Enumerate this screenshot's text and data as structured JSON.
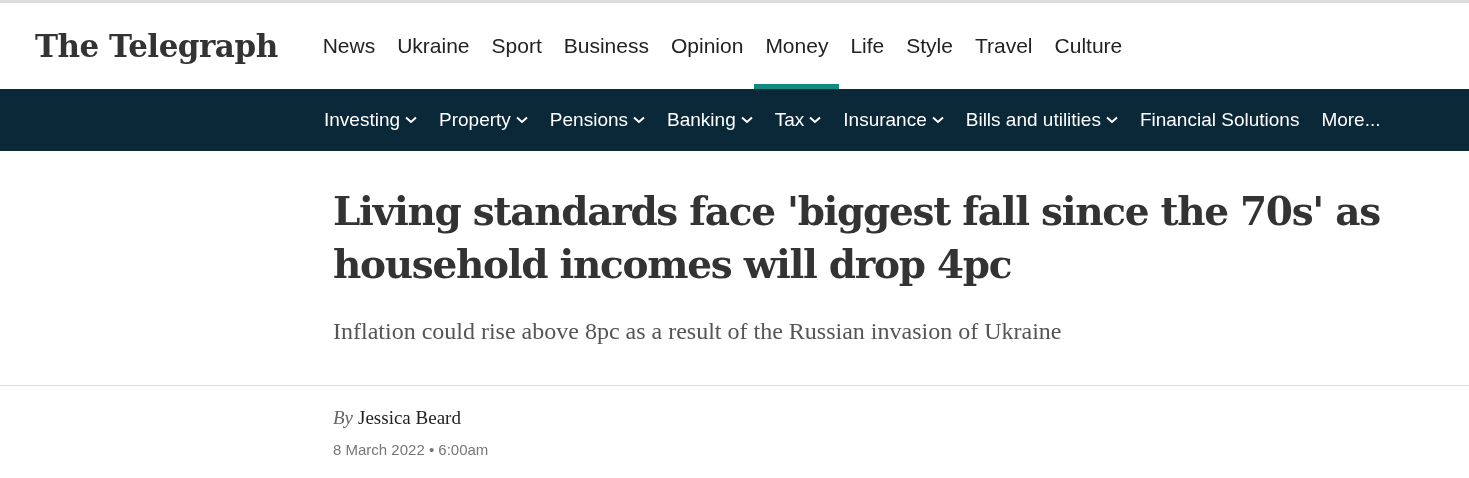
{
  "logo": "The Telegraph",
  "main_nav": [
    {
      "label": "News",
      "selected": false
    },
    {
      "label": "Ukraine",
      "selected": false
    },
    {
      "label": "Sport",
      "selected": false
    },
    {
      "label": "Business",
      "selected": false
    },
    {
      "label": "Opinion",
      "selected": false
    },
    {
      "label": "Money",
      "selected": true
    },
    {
      "label": "Life",
      "selected": false
    },
    {
      "label": "Style",
      "selected": false
    },
    {
      "label": "Travel",
      "selected": false
    },
    {
      "label": "Culture",
      "selected": false
    }
  ],
  "sub_nav": [
    {
      "label": "Investing",
      "dropdown": true
    },
    {
      "label": "Property",
      "dropdown": true
    },
    {
      "label": "Pensions",
      "dropdown": true
    },
    {
      "label": "Banking",
      "dropdown": true
    },
    {
      "label": "Tax",
      "dropdown": true
    },
    {
      "label": "Insurance",
      "dropdown": true
    },
    {
      "label": "Bills and utilities",
      "dropdown": true
    },
    {
      "label": "Financial Solutions",
      "dropdown": false
    },
    {
      "label": "More...",
      "dropdown": false
    }
  ],
  "article": {
    "headline": "Living standards face 'biggest fall since the 70s' as household incomes will drop 4pc",
    "standfirst": "Inflation could rise above 8pc as a result of the Russian invasion of Ukraine",
    "byline_prefix": "By",
    "author": "Jessica Beard",
    "date": "8 March 2022 • 6:00am"
  }
}
